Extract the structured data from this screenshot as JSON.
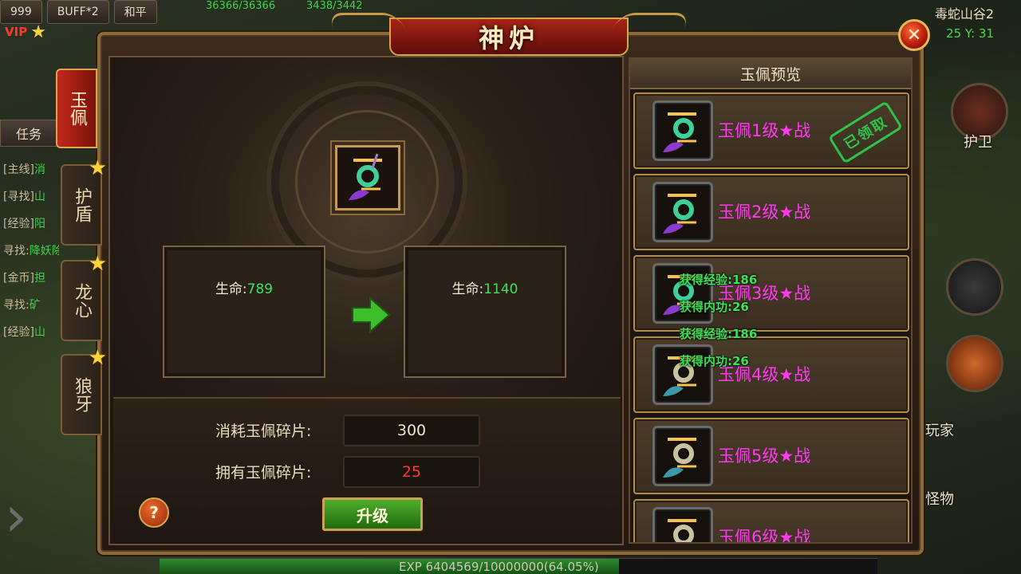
{
  "hud": {
    "level": "999",
    "buff": "BUFF*2",
    "mode": "和平",
    "vip": "VIP",
    "hp": "36366/36366",
    "mp": "3438/3442",
    "map_name": "毒蛇山谷2",
    "coord": "25  Y: 31"
  },
  "quest": {
    "tab": "任务",
    "items": [
      {
        "tag": "[主线]",
        "text": "消"
      },
      {
        "tag": "[寻找]",
        "text": "山"
      },
      {
        "tag": "[经验]",
        "text": "阳"
      },
      {
        "tag": "寻找:",
        "text": "降妖除魔"
      },
      {
        "tag": "[金币]",
        "text": "担"
      },
      {
        "tag": "寻找:",
        "text": "矿"
      },
      {
        "tag": "[经验]",
        "text": "山"
      }
    ]
  },
  "side": {
    "guard": "护卫",
    "player": "玩家",
    "monster": "怪物"
  },
  "exp": {
    "text": "EXP  6404569/10000000(64.05%)",
    "percent": 64.05
  },
  "window": {
    "title": "神炉",
    "close_glyph": "✕"
  },
  "tabs": [
    {
      "label": "玉佩",
      "active": true,
      "star": false
    },
    {
      "label": "护盾",
      "active": false,
      "star": true
    },
    {
      "label": "龙心",
      "active": false,
      "star": true
    },
    {
      "label": "狼牙",
      "active": false,
      "star": true
    }
  ],
  "upgrade": {
    "current": {
      "label": "生命:",
      "value": "789"
    },
    "next": {
      "label": "生命:",
      "value": "1140"
    },
    "cost_label": "消耗玉佩碎片:",
    "cost_value": "300",
    "own_label": "拥有玉佩碎片:",
    "own_value": "25",
    "help": "?",
    "button": "升级"
  },
  "preview": {
    "header": "玉佩预览",
    "items": [
      {
        "name": "玉佩1级★战",
        "claimed": true
      },
      {
        "name": "玉佩2级★战",
        "claimed": false
      },
      {
        "name": "玉佩3级★战",
        "claimed": false
      },
      {
        "name": "玉佩4级★战",
        "claimed": false
      },
      {
        "name": "玉佩5级★战",
        "claimed": false
      },
      {
        "name": "玉佩6级★战",
        "claimed": false
      }
    ],
    "stamp": "已领取"
  },
  "floating": [
    {
      "text": "获得经验:186"
    },
    {
      "text": "获得内功:26"
    },
    {
      "text": "获得经验:186"
    },
    {
      "text": "获得内功:26"
    }
  ],
  "colors": {
    "accent_red": "#a82418",
    "gold": "#c99a45",
    "stat_green": "#3fe060",
    "name_magenta": "#ff3aee",
    "warn_red": "#ff3a2a"
  }
}
